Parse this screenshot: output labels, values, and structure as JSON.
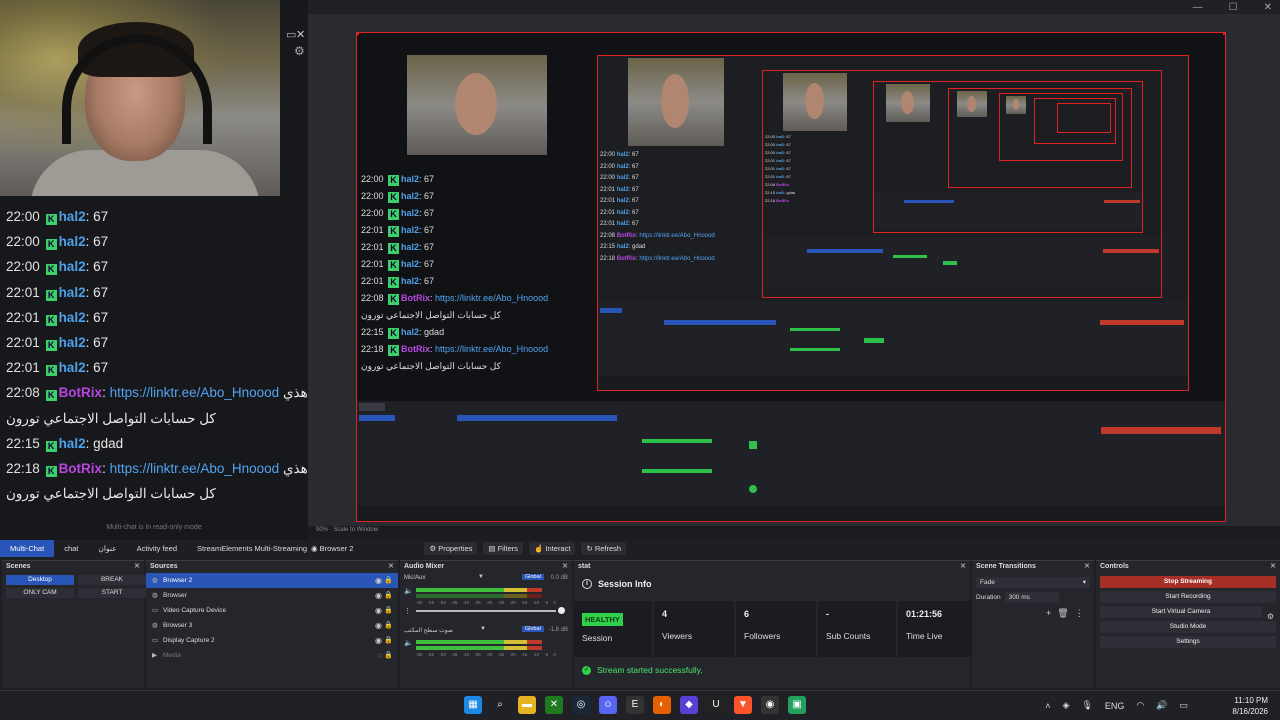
{
  "window": {
    "controls": [
      "—",
      "☐",
      "✕"
    ]
  },
  "chat": {
    "lines": [
      {
        "time": "22:00",
        "user": "hal2",
        "msg": "67"
      },
      {
        "time": "22:00",
        "user": "hal2",
        "msg": "67"
      },
      {
        "time": "22:00",
        "user": "hal2",
        "msg": "67"
      },
      {
        "time": "22:01",
        "user": "hal2",
        "msg": "67"
      },
      {
        "time": "22:01",
        "user": "hal2",
        "msg": "67"
      },
      {
        "time": "22:01",
        "user": "hal2",
        "msg": "67"
      },
      {
        "time": "22:01",
        "user": "hal2",
        "msg": "67"
      }
    ],
    "bot1": {
      "time": "22:08",
      "user": "BotRix",
      "link": "https://linktr.ee/Abo_Hnoood",
      "tail": "هذي",
      "line2": "كل حسابات التواصل الاجتماعي تورون"
    },
    "gdad": {
      "time": "22:15",
      "user": "hal2",
      "msg": "gdad"
    },
    "bot2": {
      "time": "22:18",
      "user": "BotRix",
      "link": "https://linktr.ee/Abo_Hnoood",
      "tail": "هذي",
      "line2": "كل حسابات التواصل الاجتماعي تورون"
    },
    "badge": "K",
    "readonly": "Multi-chat is in read-only mode"
  },
  "preview": {
    "zoom": "90%",
    "scale_mode": "Scale to Window"
  },
  "dock_tabs": [
    "Multi-Chat",
    "chat",
    "عنوان",
    "Activity feed",
    "StreamElements Multi-Streaming"
  ],
  "source_toolbar": {
    "source": "Browser 2",
    "properties": "Properties",
    "filters": "Filters",
    "interact": "Interact",
    "refresh": "Refresh"
  },
  "scenes": {
    "title": "Scenes",
    "items": [
      "Desktop",
      "BREAK",
      "ONLY CAM",
      "START"
    ]
  },
  "sources": {
    "title": "Sources",
    "items": [
      "Browser 2",
      "Browser",
      "Video Capture Device",
      "Browser 3",
      "Display Capture 2",
      "Media"
    ]
  },
  "mixer": {
    "title": "Audio Mixer",
    "channels": [
      {
        "name": "Mic/Aux",
        "global": "Global",
        "db": "0.0 dB"
      },
      {
        "name": "صوت سطح المكتب",
        "global": "Global",
        "db": "-1.8 dB"
      }
    ],
    "scale": [
      "-60",
      "-55",
      "-50",
      "-45",
      "-40",
      "-35",
      "-30",
      "-25",
      "-20",
      "-15",
      "-10",
      "-5",
      "0"
    ]
  },
  "stat": {
    "title": "stat",
    "header": "Session Info",
    "health": "HEALTHY",
    "cells": [
      {
        "value": "",
        "label": "Session"
      },
      {
        "value": "4",
        "label": "Viewers"
      },
      {
        "value": "6",
        "label": "Followers"
      },
      {
        "value": "-",
        "label": "Sub Counts"
      },
      {
        "value": "01:21:56",
        "label": "Time Live"
      }
    ],
    "status": "Stream started successfully."
  },
  "transitions": {
    "title": "Scene Transitions",
    "selected": "Fade",
    "duration_label": "Duration",
    "duration_value": "300 ms"
  },
  "controls": {
    "title": "Controls",
    "buttons": [
      "Stop Streaming",
      "Start Recording",
      "Start Virtual Camera",
      "Studio Mode",
      "Settings"
    ]
  },
  "taskbar": {
    "lang": "ENG",
    "time": "11:10 PM",
    "date": "8/16/2026"
  },
  "colors": {
    "accent": "#2a55b8",
    "stop": "#a52e26",
    "healthy": "#2fd04a",
    "canvas_border": "#e02222"
  }
}
